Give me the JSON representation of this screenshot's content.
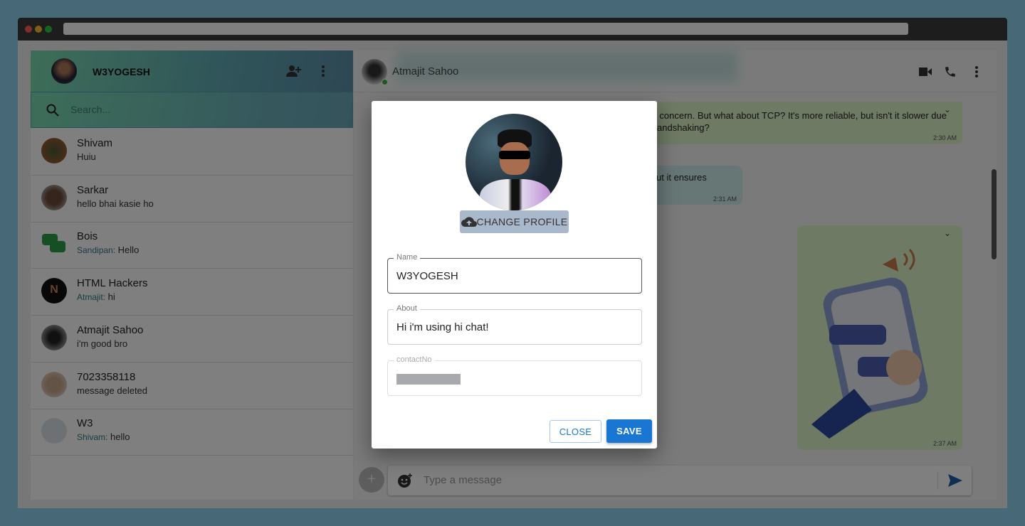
{
  "browser": {
    "dots": [
      "#ff5f57",
      "#febc2e",
      "#28c840"
    ]
  },
  "sidebar": {
    "user_name": "W3YOGESH",
    "search_placeholder": "Search...",
    "chats": [
      {
        "name": "Shivam",
        "message": "Huiu",
        "sender": ""
      },
      {
        "name": "Sarkar",
        "message": "hello bhai kasie ho",
        "sender": ""
      },
      {
        "name": "Bois",
        "message": "Hello",
        "sender": "Sandipan:"
      },
      {
        "name": "HTML Hackers",
        "message": "hi",
        "sender": "Atmajit:"
      },
      {
        "name": "Atmajit Sahoo",
        "message": "i'm good bro",
        "sender": ""
      },
      {
        "name": "7023358118",
        "message": "message deleted",
        "sender": ""
      },
      {
        "name": "W3",
        "message": "hello",
        "sender": "Shivam:"
      }
    ]
  },
  "chat": {
    "contact_name": "Atmajit Sahoo",
    "messages": [
      {
        "line1": "s a concern. But what about TCP? It's more reliable, but isn't it slower due",
        "line2": "andshaking?",
        "time": "2:30 AM"
      },
      {
        "line1": "ut it ensures",
        "time": "2:31 AM"
      },
      {
        "time": "2:37 AM"
      }
    ],
    "input_placeholder": "Type a message"
  },
  "modal": {
    "change_profile_label": "CHANGE PROFILE",
    "name_label": "Name",
    "name_value": "W3YOGESH",
    "about_label": "About",
    "about_value": "Hi i'm using hi chat!",
    "contact_label": "contactNo",
    "close_label": "CLOSE",
    "save_label": "SAVE"
  },
  "colors": {
    "accent": "#1976d2",
    "header_gradient_start": "#7bdcb1",
    "header_gradient_end": "#5b8fa8"
  }
}
